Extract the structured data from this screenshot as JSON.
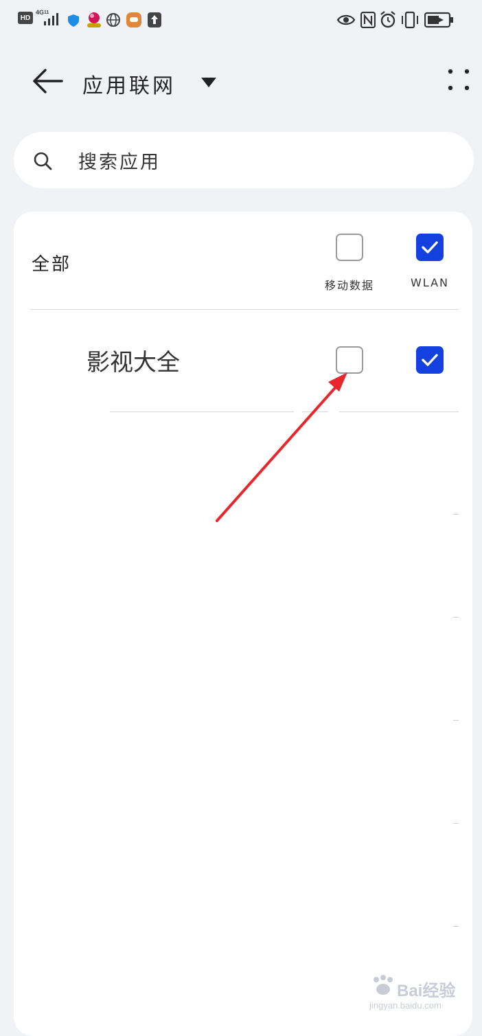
{
  "status_bar": {
    "hd_label": "HD",
    "network_label": "4G",
    "network_sub": "11",
    "icons_left": [
      "signal-bars-icon",
      "shield-icon",
      "app-badge-icon",
      "globe-icon",
      "message-icon",
      "upload-icon"
    ],
    "icons_right": [
      "eye-icon",
      "nfc-icon",
      "alarm-icon",
      "vibrate-icon",
      "battery-icon"
    ]
  },
  "header": {
    "title": "应用联网"
  },
  "search": {
    "placeholder": "搜索应用"
  },
  "list": {
    "all_label": "全部",
    "columns": {
      "mobile_data": "移动数据",
      "wlan": "WLAN"
    },
    "all_mobile_checked": false,
    "all_wlan_checked": true,
    "apps": [
      {
        "name": "影视大全",
        "mobile_checked": false,
        "wlan_checked": true
      }
    ]
  },
  "colors": {
    "accent": "#1440e0",
    "annotation_arrow": "#e8262b",
    "background": "#f1f2f6"
  },
  "watermark": {
    "brand": "Bai经验",
    "url": "jingyan.baidu.com"
  }
}
